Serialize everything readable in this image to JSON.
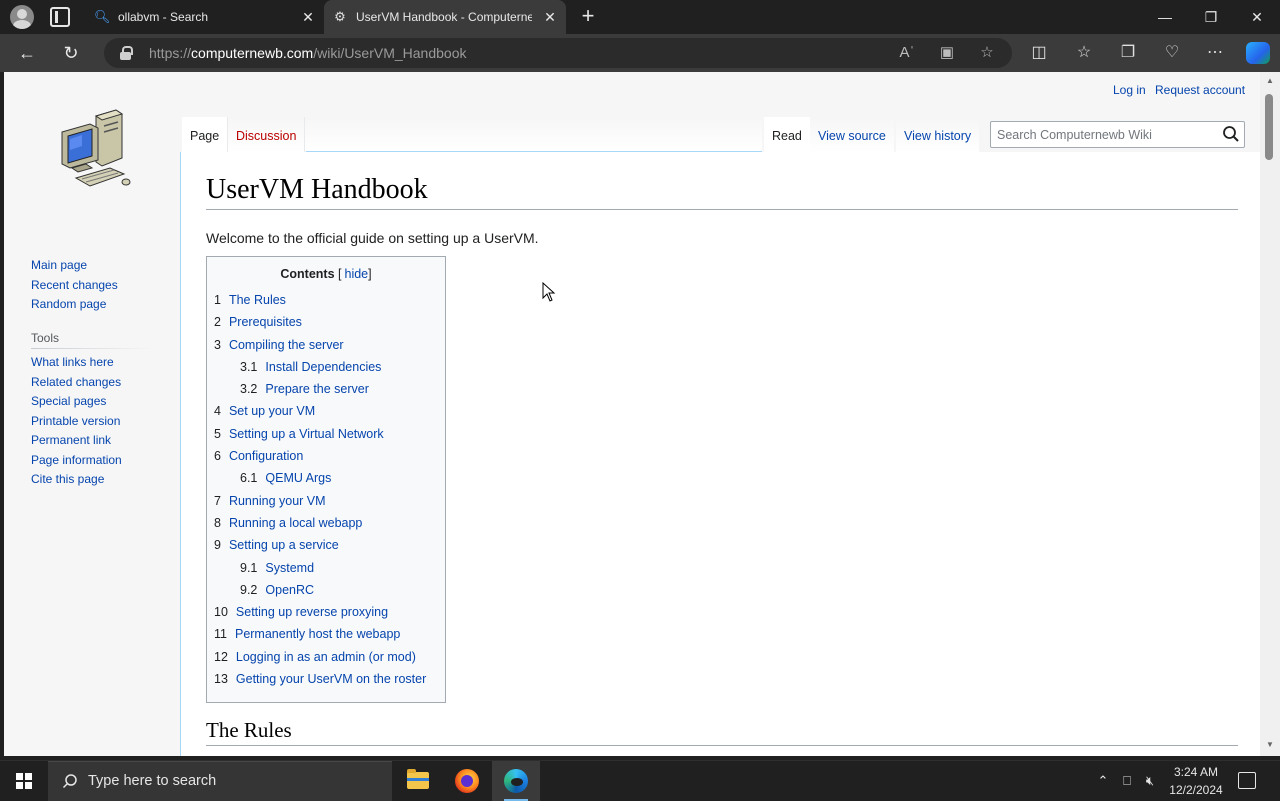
{
  "browser": {
    "tabs": [
      {
        "title": "ollabvm - Search",
        "favicon": "search-icon"
      },
      {
        "title": "UserVM Handbook - Computernewb Wiki",
        "favicon": "wiki-icon"
      }
    ],
    "url_prefix": "https://",
    "url_host": "computernewb.com",
    "url_path": "/wiki/UserVM_Handbook"
  },
  "page": {
    "personal": {
      "login": "Log in",
      "request": "Request account"
    },
    "tabs": {
      "page": "Page",
      "discussion": "Discussion",
      "read": "Read",
      "view_source": "View source",
      "view_history": "View history"
    },
    "search_placeholder": "Search Computernewb Wiki",
    "navigation": [
      "Main page",
      "Recent changes",
      "Random page"
    ],
    "tools_heading": "Tools",
    "tools": [
      "What links here",
      "Related changes",
      "Special pages",
      "Printable version",
      "Permanent link",
      "Page information",
      "Cite this page"
    ],
    "title": "UserVM Handbook",
    "intro": "Welcome to the official guide on setting up a UserVM.",
    "toc": {
      "title": "Contents",
      "bracket_open": "[",
      "hide": "hide",
      "bracket_close": "]",
      "items": [
        {
          "num": "1",
          "label": "The Rules",
          "level": 1
        },
        {
          "num": "2",
          "label": "Prerequisites",
          "level": 1
        },
        {
          "num": "3",
          "label": "Compiling the server",
          "level": 1
        },
        {
          "num": "3.1",
          "label": "Install Dependencies",
          "level": 2
        },
        {
          "num": "3.2",
          "label": "Prepare the server",
          "level": 2
        },
        {
          "num": "4",
          "label": "Set up your VM",
          "level": 1
        },
        {
          "num": "5",
          "label": "Setting up a Virtual Network",
          "level": 1
        },
        {
          "num": "6",
          "label": "Configuration",
          "level": 1
        },
        {
          "num": "6.1",
          "label": "QEMU Args",
          "level": 2
        },
        {
          "num": "7",
          "label": "Running your VM",
          "level": 1
        },
        {
          "num": "8",
          "label": "Running a local webapp",
          "level": 1
        },
        {
          "num": "9",
          "label": "Setting up a service",
          "level": 1
        },
        {
          "num": "9.1",
          "label": "Systemd",
          "level": 2
        },
        {
          "num": "9.2",
          "label": "OpenRC",
          "level": 2
        },
        {
          "num": "10",
          "label": "Setting up reverse proxying",
          "level": 1
        },
        {
          "num": "11",
          "label": "Permanently host the webapp",
          "level": 1
        },
        {
          "num": "12",
          "label": "Logging in as an admin (or mod)",
          "level": 1
        },
        {
          "num": "13",
          "label": "Getting your UserVM on the roster",
          "level": 1
        }
      ]
    },
    "section1_heading": "The Rules"
  },
  "taskbar": {
    "search_placeholder": "Type here to search",
    "time": "3:24 AM",
    "date": "12/2/2024"
  },
  "colors": {
    "link": "#0645ad",
    "new_link": "#ba0000",
    "tab_active_bg": "#3b3b3b",
    "taskbar_bg": "#202020"
  }
}
